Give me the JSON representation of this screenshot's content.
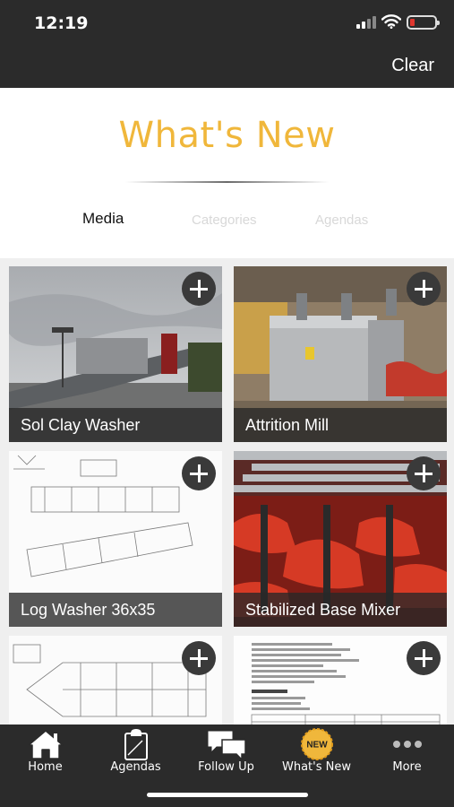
{
  "status_bar": {
    "time": "12:19"
  },
  "nav": {
    "clear_label": "Clear"
  },
  "header": {
    "title": "What's New"
  },
  "tabs": [
    {
      "label": "Media",
      "active": true
    },
    {
      "label": "Categories",
      "active": false
    },
    {
      "label": "Agendas",
      "active": false
    }
  ],
  "cards": [
    {
      "title": "Sol Clay Washer"
    },
    {
      "title": "Attrition Mill"
    },
    {
      "title": "Log Washer 36x35"
    },
    {
      "title": "Stabilized Base Mixer"
    },
    {
      "title": ""
    },
    {
      "title": ""
    }
  ],
  "tab_bar": {
    "items": [
      {
        "label": "Home",
        "icon": "home-icon"
      },
      {
        "label": "Agendas",
        "icon": "clipboard-icon"
      },
      {
        "label": "Follow Up",
        "icon": "chat-bubbles-icon"
      },
      {
        "label": "What's New",
        "icon": "new-badge-icon",
        "badge": "NEW"
      },
      {
        "label": "More",
        "icon": "more-dots-icon"
      }
    ]
  },
  "colors": {
    "accent": "#f0b73b",
    "bar": "#2b2b2b",
    "battery_low": "#e0362e"
  }
}
